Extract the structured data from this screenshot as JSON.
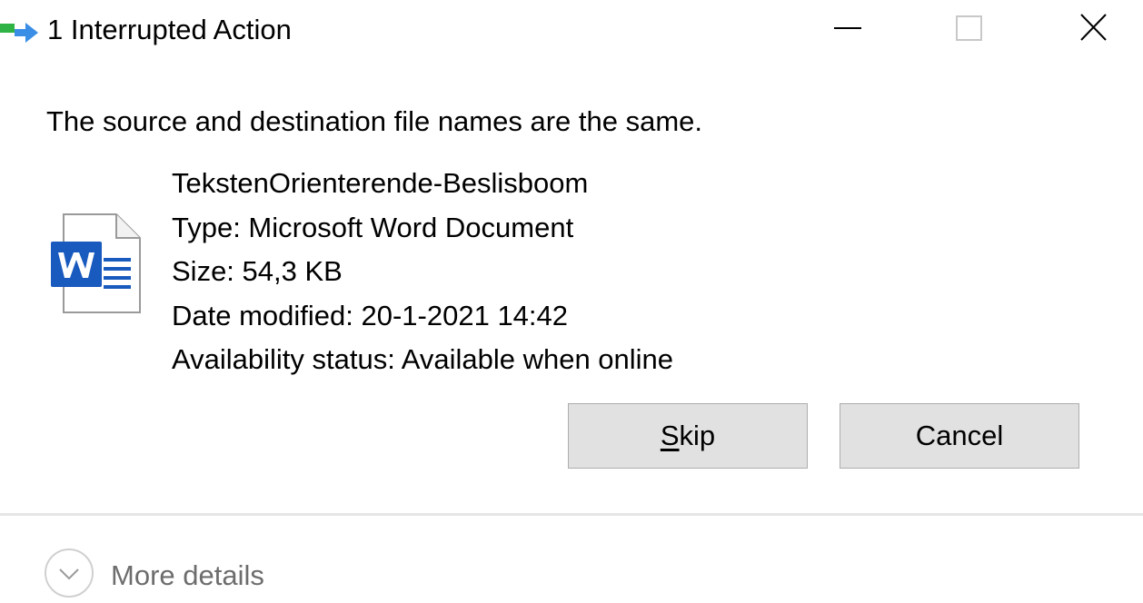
{
  "window": {
    "title": "1 Interrupted Action",
    "icons": {
      "app": "file-move-icon",
      "minimize": "minimize-icon",
      "maximize": "maximize-icon",
      "close": "close-icon"
    }
  },
  "dialog": {
    "message": "The source and destination file names are the same.",
    "file": {
      "icon": "word-document-icon",
      "name": "TekstenOrienterende-Beslisboom",
      "type": "Type: Microsoft Word Document",
      "size": "Size: 54,3 KB",
      "date_modified": "Date modified: 20-1-2021 14:42",
      "availability": "Availability status: Available when online"
    },
    "buttons": {
      "skip_mnemonic": "S",
      "skip_rest": "kip",
      "cancel": "Cancel"
    }
  },
  "footer": {
    "more_details": "More details",
    "icon": "chevron-down-icon"
  },
  "colors": {
    "word_blue": "#185abd",
    "button_bg": "#e1e1e1",
    "button_border": "#adadad",
    "muted_text": "#6d6d6d"
  }
}
